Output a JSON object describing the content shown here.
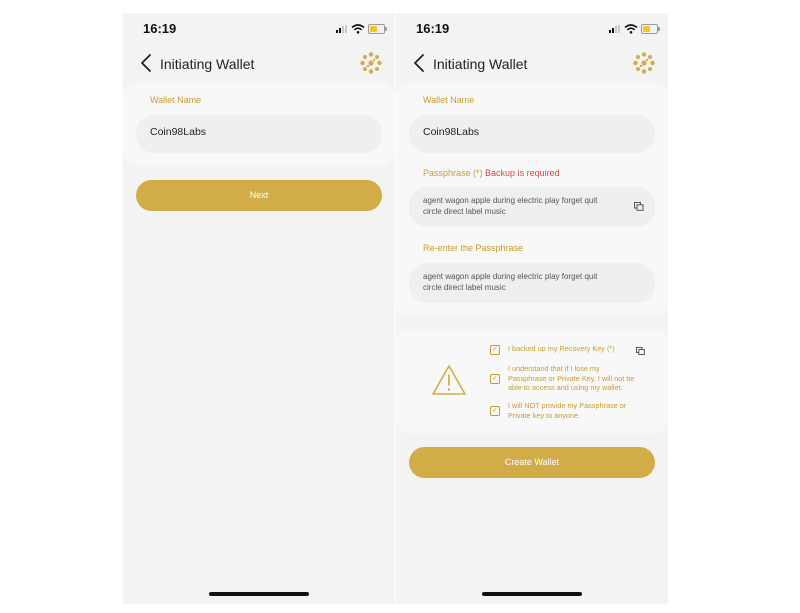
{
  "status_bar": {
    "time": "16:19"
  },
  "header": {
    "title": "Initiating Wallet"
  },
  "left_screen": {
    "wallet_name_label": "Wallet Name",
    "wallet_name_value": "Coin98Labs",
    "next_button": "Next"
  },
  "right_screen": {
    "wallet_name_label": "Wallet Name",
    "wallet_name_value": "Coin98Labs",
    "passphrase_label": "Passphrase (*)",
    "backup_required": "Backup is required",
    "passphrase_line1": "agent wagon apple during electric play forget quit",
    "passphrase_line2": "circle direct label music",
    "reenter_label": "Re-enter the Passphrase",
    "reenter_line1": "agent wagon apple during electric play forget quit",
    "reenter_line2": "circle direct label music",
    "checks": [
      {
        "line1": "I backed up my Recovery Key (*)",
        "checked": true
      },
      {
        "line1": "I understand that if I lose my",
        "line2": "Passphrase or Private Key, I will not be",
        "line3": "able to access and using my wallet.",
        "checked": true
      },
      {
        "line1": "I will NOT provide my Passphrase or",
        "line2": "Private key to anyone.",
        "checked": true
      }
    ],
    "create_button": "Create Wallet"
  },
  "icons": {
    "back": "chevron-left-icon",
    "logo": "coin98-logo-icon",
    "copy": "copy-icon",
    "warning": "warning-triangle-icon",
    "checkbox": "check-icon"
  },
  "colors": {
    "accent": "#d2ac47",
    "label": "#c69c2e",
    "required": "#e0463f",
    "background": "#f3f3f3"
  }
}
